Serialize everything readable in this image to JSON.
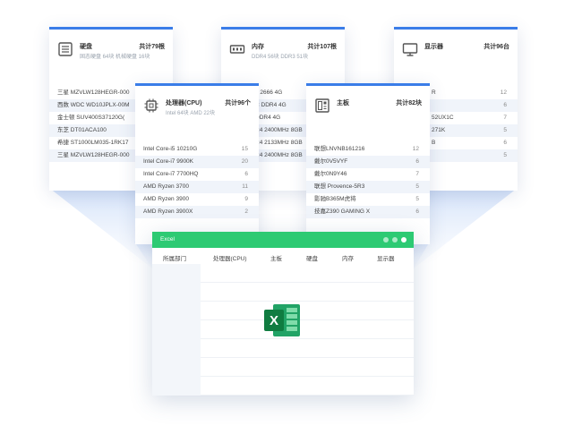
{
  "cards": {
    "disk": {
      "title": "硬盘",
      "count": "共计79根",
      "subtitle": "固态硬盘 64块  机械硬盘 16块",
      "rows": [
        {
          "name": "三星 MZVLW128HEGR-000"
        },
        {
          "name": "西数 WDC WD10JPLX-00M"
        },
        {
          "name": "金士顿 SUV400S37120G("
        },
        {
          "name": "东芝 DT01ACA100"
        },
        {
          "name": "希捷 ST1000LM035-1RK17"
        },
        {
          "name": "三星 MZVLW128HEGR-000"
        }
      ]
    },
    "memory": {
      "title": "内存",
      "count": "共计107根",
      "subtitle": "DDR4 56块  DDR3 51块",
      "rows": [
        {
          "name": "4 2666 4G"
        },
        {
          "name": "C DDR4 4G"
        },
        {
          "name": "DDR4 4G"
        },
        {
          "name": "R4 2400MHz 8GB"
        },
        {
          "name": "R4 2133MHz 8GB"
        },
        {
          "name": "R4 2400MHz 8GB"
        }
      ]
    },
    "monitor": {
      "title": "显示器",
      "count": "共计96台",
      "rows": [
        {
          "name": "R",
          "count": "12"
        },
        {
          "name": "",
          "count": "6"
        },
        {
          "name": "52UX1C",
          "count": "7"
        },
        {
          "name": "271K",
          "count": "5"
        },
        {
          "name": "B",
          "count": "6"
        },
        {
          "name": "",
          "count": "5"
        }
      ]
    },
    "cpu": {
      "title": "处理器(CPU)",
      "count": "共计96个",
      "subtitle": "Intel 64块  AMD 22块",
      "rows": [
        {
          "name": "Intel Core-i5 10210G",
          "count": "15"
        },
        {
          "name": "Intel Core-i7 9900K",
          "count": "20"
        },
        {
          "name": "Intel Core-i7 7700HQ",
          "count": "6"
        },
        {
          "name": "AMD Ryzen 3700",
          "count": "11"
        },
        {
          "name": "AMD Ryzen 3900",
          "count": "9"
        },
        {
          "name": "AMD Ryzen 3900X",
          "count": "2"
        }
      ]
    },
    "board": {
      "title": "主板",
      "count": "共计82块",
      "rows": [
        {
          "name": "联想LNVNB161216",
          "count": "12"
        },
        {
          "name": "戴尔0V5VYF",
          "count": "6"
        },
        {
          "name": "戴尔0N9Y46",
          "count": "7"
        },
        {
          "name": "联想 Provence-5R3",
          "count": "5"
        },
        {
          "name": "影驰B365M虎将",
          "count": "5"
        },
        {
          "name": "技嘉Z390 GAMING X",
          "count": "6"
        }
      ]
    }
  },
  "excel": {
    "title": "Excel",
    "columns": [
      "所属部门",
      "处理器(CPU)",
      "主板",
      "硬盘",
      "内存",
      "显示器"
    ],
    "logo_letter": "X"
  },
  "colors": {
    "accent": "#3a7de8",
    "excel_green": "#2dca73",
    "beam": "#d9e6fb"
  }
}
